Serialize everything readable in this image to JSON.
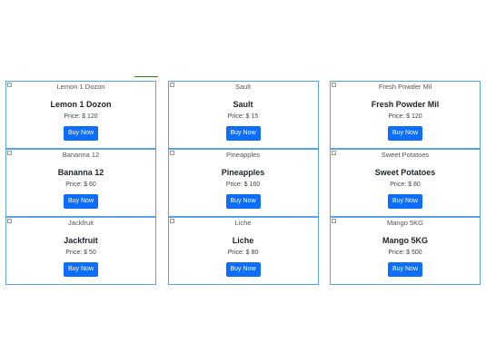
{
  "products": [
    {
      "image_alt": "Lemon 1 Dozon",
      "name": "Lemon 1 Dozon",
      "price": "Price: $ 120",
      "button": "Buy Now"
    },
    {
      "image_alt": "Sault",
      "name": "Sault",
      "price": "Price: $ 15",
      "button": "Buy Now"
    },
    {
      "image_alt": "Fresh Powder Mil",
      "name": "Fresh Powder Mil",
      "price": "Price: $ 120",
      "button": "Buy Now"
    },
    {
      "image_alt": "Bananna 12",
      "name": "Bananna 12",
      "price": "Price: $ 60",
      "button": "Buy Now"
    },
    {
      "image_alt": "Pineapples",
      "name": "Pineapples",
      "price": "Price: $ 160",
      "button": "Buy Now"
    },
    {
      "image_alt": "Sweet Potatoes",
      "name": "Sweet Potatoes",
      "price": "Price: $ 80",
      "button": "Buy Now"
    },
    {
      "image_alt": "Jackfruit",
      "name": "Jackfruit",
      "price": "Price: $ 50",
      "button": "Buy Now"
    },
    {
      "image_alt": "Liche",
      "name": "Liche",
      "price": "Price: $ 80",
      "button": "Buy Now"
    },
    {
      "image_alt": "Mango 5KG",
      "name": "Mango 5KG",
      "price": "Price: $ 500",
      "button": "Buy Now"
    }
  ],
  "colors": {
    "card_border": "#5aa2e6",
    "button_bg": "#0d6efd",
    "button_text": "#ffffff",
    "accent_line": "#2e7d32"
  }
}
